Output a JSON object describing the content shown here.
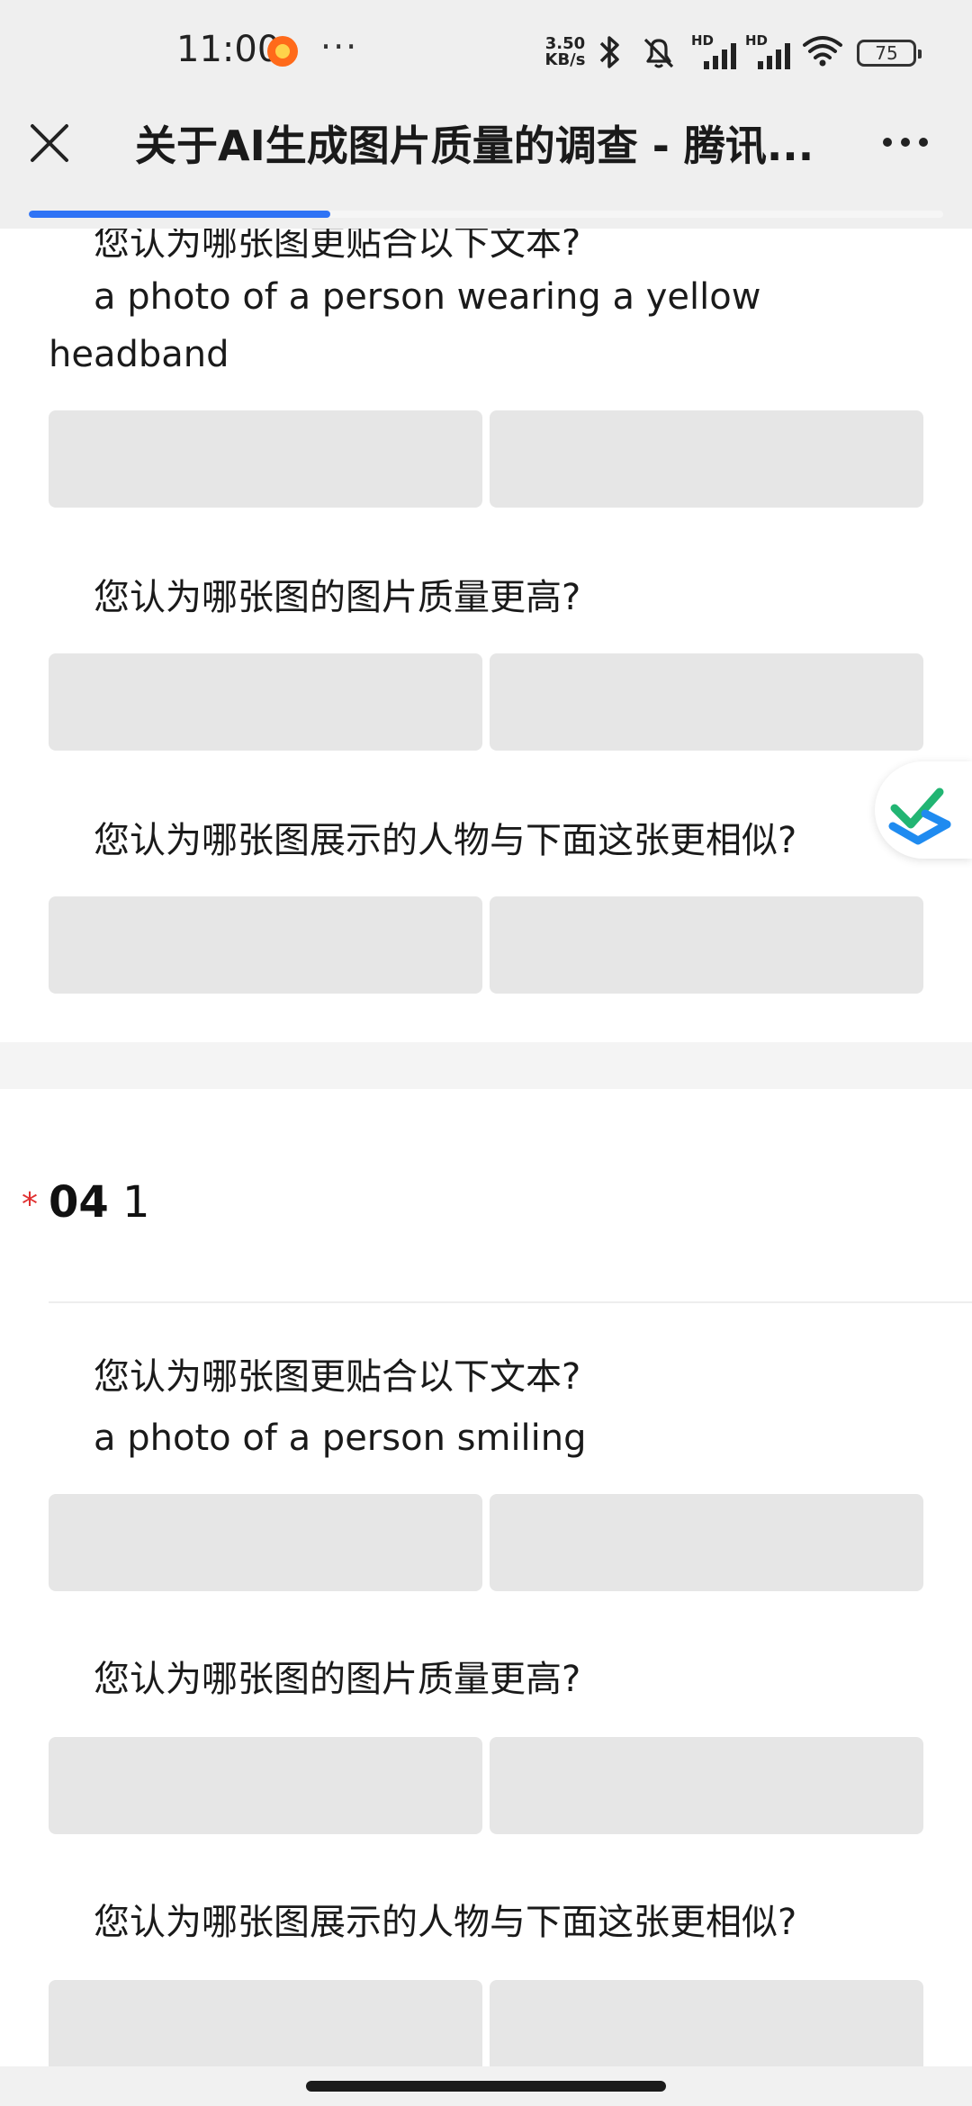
{
  "status_bar": {
    "time": "11:00",
    "more": "···",
    "net_speed_value": "3.50",
    "net_speed_unit": "KB/s",
    "signal_tag_1": "HD",
    "signal_tag_2": "HD",
    "battery": "75"
  },
  "header": {
    "title": "关于AI生成图片质量的调查 - 腾讯..."
  },
  "progress": {
    "fraction": 0.33,
    "color": "#2f73f5"
  },
  "section_prev": {
    "q1_title": "您认为哪张图更贴合以下文本?",
    "q1_text_line1": "a photo of a person wearing a yellow",
    "q1_text_line2": "headband",
    "q2_title": "您认为哪张图的图片质量更高?",
    "q3_title": "您认为哪张图展示的人物与下面这张更相似?"
  },
  "section_04": {
    "required_mark": "*",
    "number": "04",
    "title": "1",
    "q1_title": "您认为哪张图更贴合以下文本?",
    "q1_text": "a photo of a person smiling",
    "q2_title": "您认为哪张图的图片质量更高?",
    "q3_title": "您认为哪张图展示的人物与下面这张更相似?"
  },
  "colors": {
    "accent": "#2f73f5",
    "required": "#e03030",
    "option_bg": "#e6e6e6",
    "fab_check_green": "#22b573",
    "fab_check_blue": "#1f8bf0"
  },
  "icons": {
    "close": "close-icon",
    "more": "more-horizontal-icon",
    "fab": "check-badge-icon",
    "bluetooth": "bluetooth-icon",
    "mute": "bell-muted-icon",
    "wifi": "wifi-icon"
  }
}
